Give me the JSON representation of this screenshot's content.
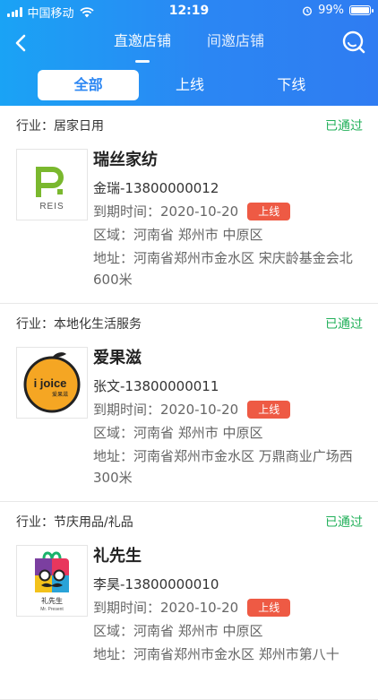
{
  "status_bar": {
    "carrier": "中国移动",
    "time": "12:19",
    "battery": "99%",
    "battery_level": 0.99
  },
  "nav": {
    "tabs": [
      {
        "label": "直邀店铺",
        "active": true
      },
      {
        "label": "间邀店铺",
        "active": false
      }
    ],
    "icons": {
      "back": "back-arrow-icon",
      "search": "search-icon"
    }
  },
  "filter": {
    "options": [
      {
        "label": "全部",
        "active": true
      },
      {
        "label": "上线",
        "active": false
      },
      {
        "label": "下线",
        "active": false
      }
    ]
  },
  "colors": {
    "header_start": "#1aa3f5",
    "header_end": "#2f7cf2",
    "approved": "#22b05a",
    "online_badge": "#ee5a44"
  },
  "shops": [
    {
      "industry": "行业：居家日用",
      "audit_status": "已通过",
      "name": "瑞丝家纺",
      "contact": "金瑞-13800000012",
      "expire": "到期时间：2020-10-20",
      "badge": "上线",
      "region": "区域：河南省 郑州市 中原区",
      "address": "地址：河南省郑州市金水区 宋庆龄基金会北600米",
      "logo_text": "REIS"
    },
    {
      "industry": "行业：本地化生活服务",
      "audit_status": "已通过",
      "name": "爱果滋",
      "contact": "张文-13800000011",
      "expire": "到期时间：2020-10-20",
      "badge": "上线",
      "region": "区域：河南省 郑州市 中原区",
      "address": "地址：河南省郑州市金水区 万鼎商业广场西300米",
      "logo_text": "i joice",
      "logo_subtext": "爱果滋"
    },
    {
      "industry": "行业：节庆用品/礼品",
      "audit_status": "已通过",
      "name": "礼先生",
      "contact": "李昊-13800000010",
      "expire": "到期时间：2020-10-20",
      "badge": "上线",
      "region": "区域：河南省 郑州市 中原区",
      "address": "地址：河南省郑州市金水区 郑州市第八十",
      "logo_text": "礼先生",
      "logo_subtext": "Mr. Present"
    }
  ]
}
